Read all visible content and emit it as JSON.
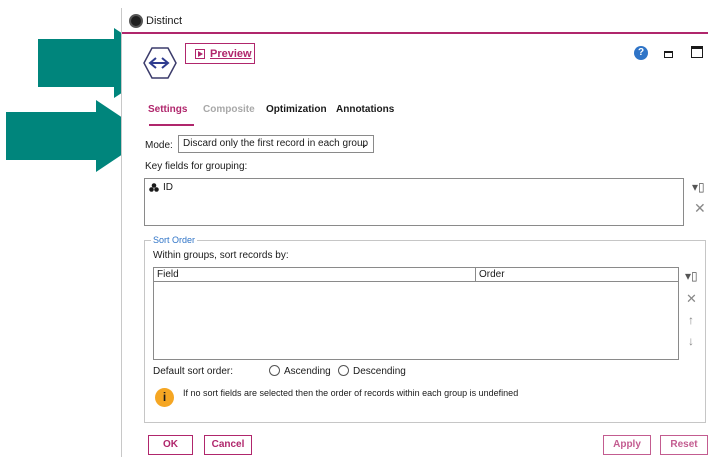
{
  "window": {
    "title": "Distinct"
  },
  "toolbar": {
    "preview_label": "Preview"
  },
  "tabs": [
    {
      "label": "Settings",
      "state": "active"
    },
    {
      "label": "Composite",
      "state": "disabled"
    },
    {
      "label": "Optimization",
      "state": "normal"
    },
    {
      "label": "Annotations",
      "state": "normal"
    }
  ],
  "settings": {
    "mode_label": "Mode:",
    "mode_value": "Discard only the first record in each group",
    "key_fields_label": "Key fields for grouping:",
    "key_fields": [
      {
        "name": "ID",
        "icon": "nominal-set-icon"
      }
    ]
  },
  "sort_order": {
    "group_label": "Sort Order",
    "within_label": "Within groups, sort records by:",
    "columns": [
      "Field",
      "Order"
    ],
    "rows": [],
    "default_sort_label": "Default sort order:",
    "ascending_label": "Ascending",
    "descending_label": "Descending",
    "info_text": "If no sort fields are selected then the order of records within each group is undefined"
  },
  "buttons": {
    "ok": "OK",
    "cancel": "Cancel",
    "apply": "Apply",
    "reset": "Reset"
  },
  "colors": {
    "accent": "#b0266c",
    "arrow": "#00857c",
    "link_blue": "#2f74c7",
    "info_orange": "#f5a623"
  }
}
